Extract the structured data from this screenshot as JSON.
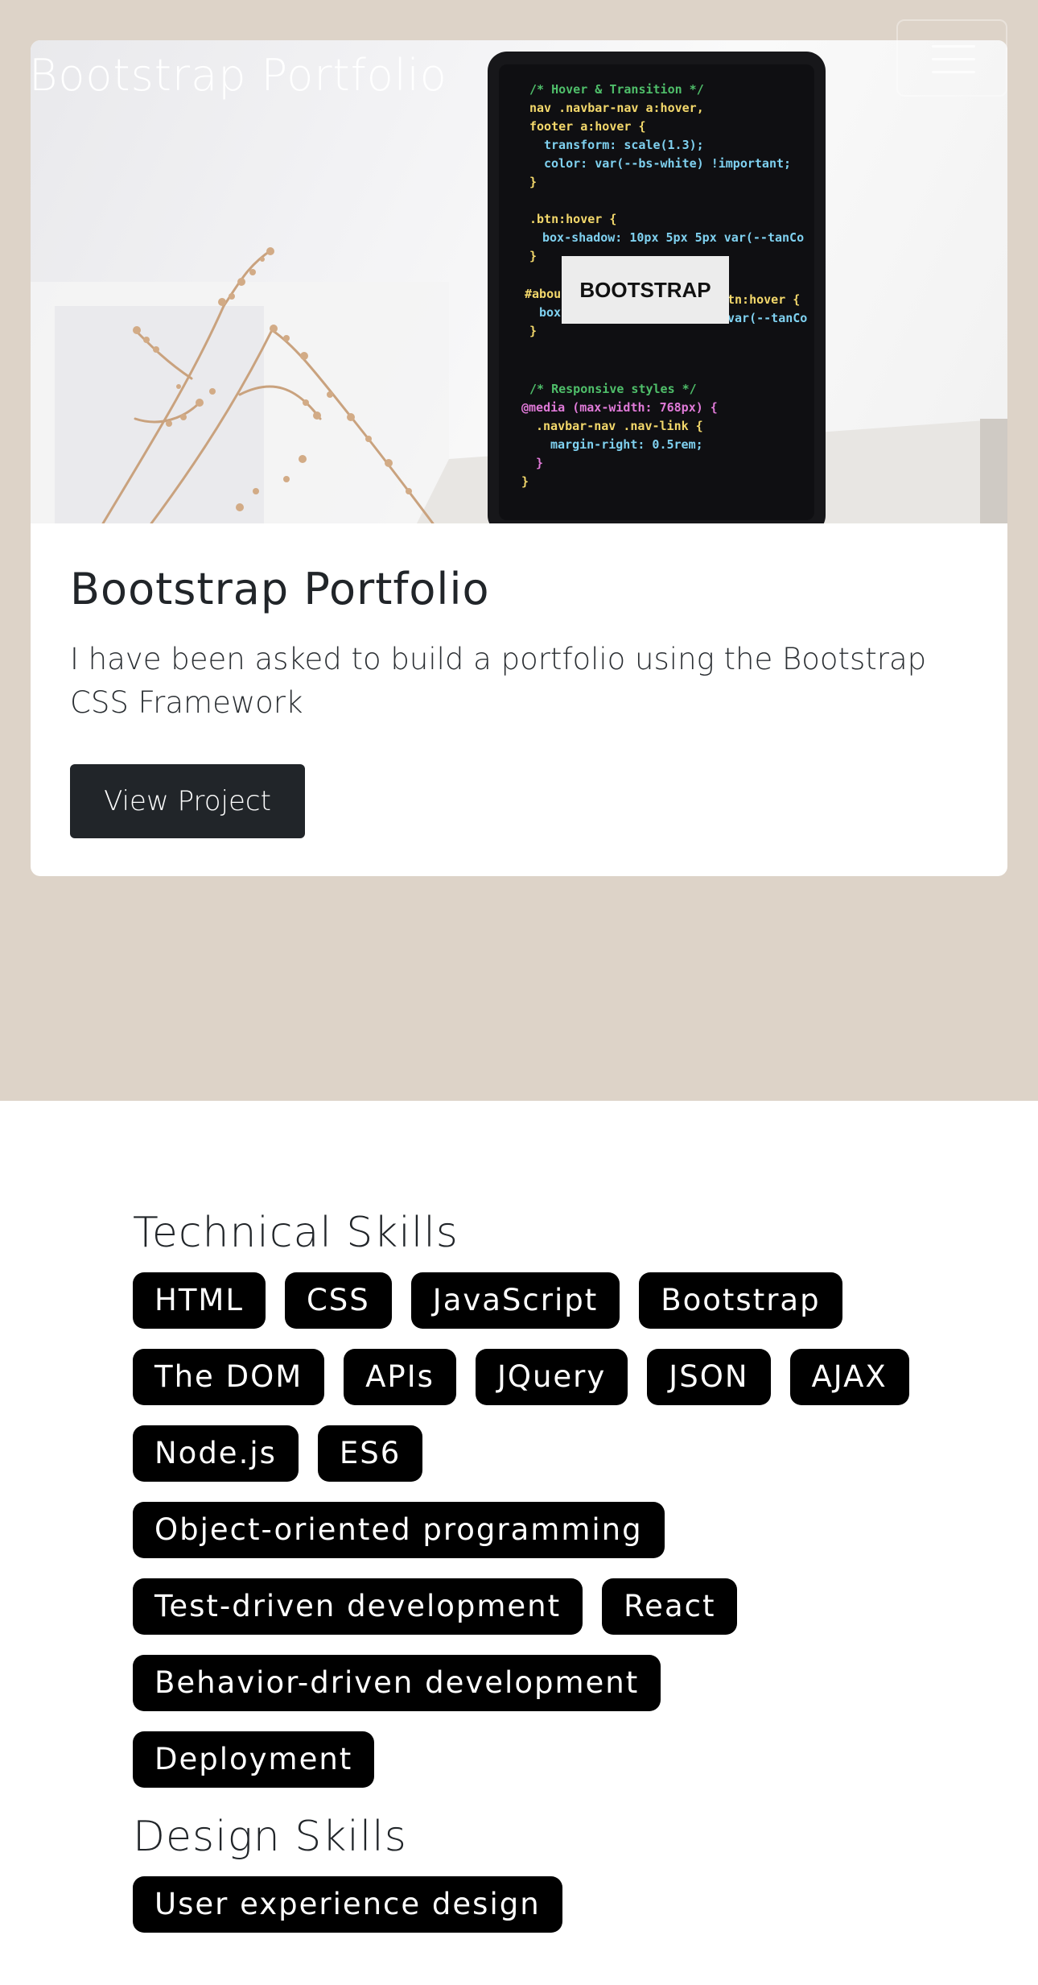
{
  "navbar": {
    "brand": "Bootstrap Portfolio",
    "toggler_icon": "hamburger-menu-icon"
  },
  "project_card": {
    "image_alt": "Tablet displaying CSS code next to dried flowers",
    "image_code_lines": [
      "/* Hover & Transition */",
      "nav .navbar-nav a:hover,",
      "footer a:hover {",
      "transform: scale(1.3);",
      "color: var(--bs-white) !important;",
      "}",
      ".btn:hover {",
      "box-shadow: 10px 5px 5px var(--tanCo",
      "}",
      "#abou",
      "box",
      "tn:hover {",
      "var(--tanCo",
      "}",
      "/* Responsive styles */",
      "@media (max-width: 768px) {",
      ".navbar-nav .nav-link {",
      "margin-right: 0.5rem;",
      "}",
      "}"
    ],
    "image_label": "BOOTSTRAP",
    "title": "Bootstrap Portfolio",
    "description": "I have been asked to build a portfolio using the Bootstrap CSS Framework",
    "button_label": "View Project"
  },
  "technical_skills": {
    "heading": "Technical Skills",
    "items": [
      "HTML",
      "CSS",
      "JavaScript",
      "Bootstrap",
      "The DOM",
      "APIs",
      "JQuery",
      "JSON",
      "AJAX",
      "Node.js",
      "ES6",
      "Object-oriented programming",
      "Test-driven development",
      "React",
      "Behavior-driven development",
      "Deployment"
    ]
  },
  "design_skills": {
    "heading": "Design Skills",
    "items": [
      "User experience design"
    ]
  },
  "colors": {
    "hero_background": "#ddd3c8",
    "badge_background": "#000000",
    "button_background": "#212529"
  }
}
